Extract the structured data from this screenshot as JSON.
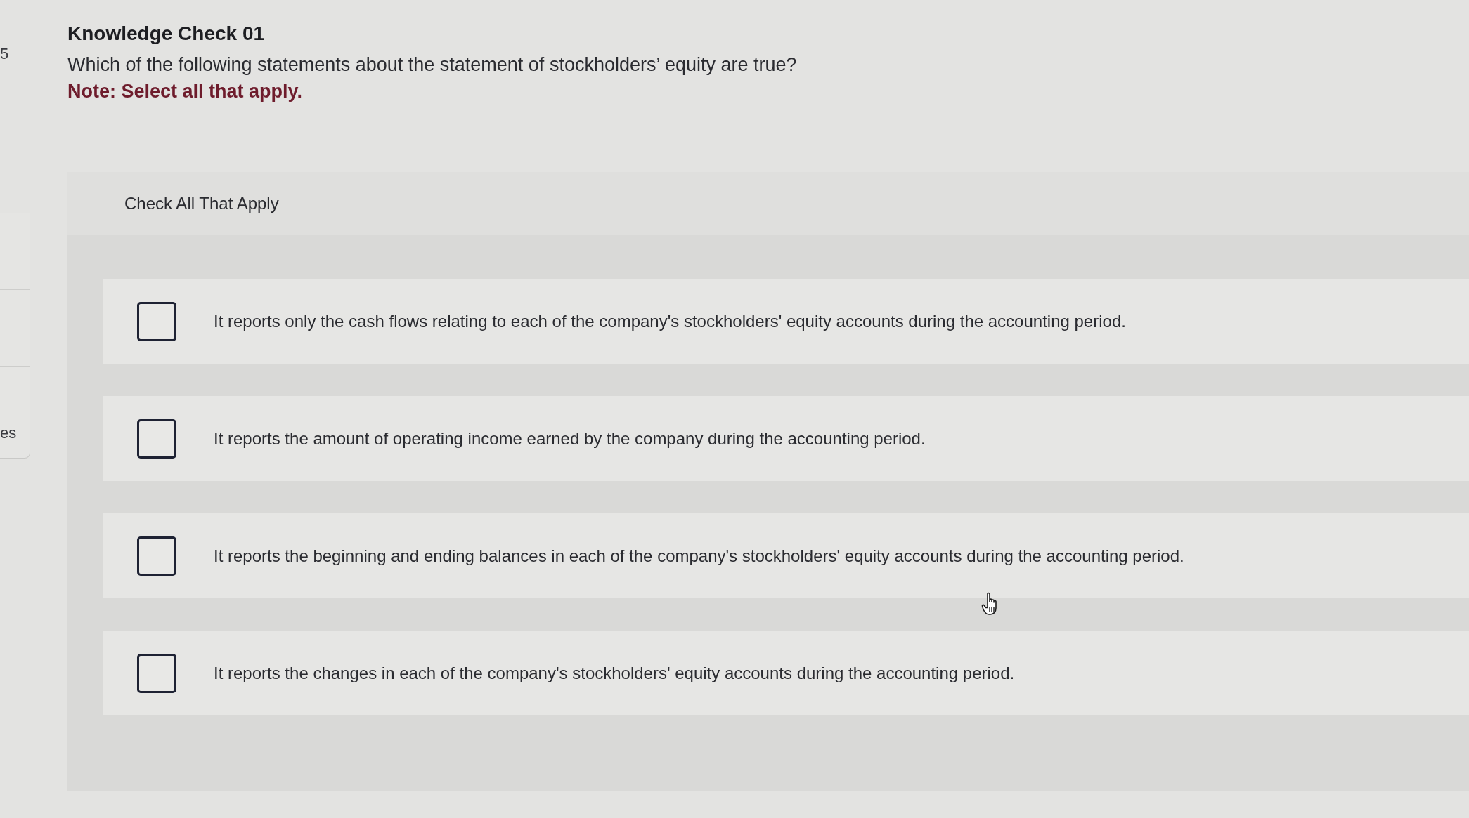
{
  "sidebar": {
    "number": "5",
    "label": "es"
  },
  "question": {
    "title": "Knowledge Check 01",
    "prompt": "Which of the following statements about the statement of stockholders’ equity are true?",
    "note": "Note: Select all that apply."
  },
  "answer_panel": {
    "heading": "Check All That Apply",
    "options": [
      {
        "text": "It reports only the cash flows relating to each of the company's stockholders' equity accounts during the accounting period.",
        "checked": false
      },
      {
        "text": "It reports the amount of operating income earned by the company during the accounting period.",
        "checked": false
      },
      {
        "text": "It reports the beginning and ending balances in each of the company's stockholders' equity accounts during the accounting period.",
        "checked": false
      },
      {
        "text": "It reports the changes in each of the company's stockholders' equity accounts during the accounting period.",
        "checked": false
      }
    ]
  }
}
